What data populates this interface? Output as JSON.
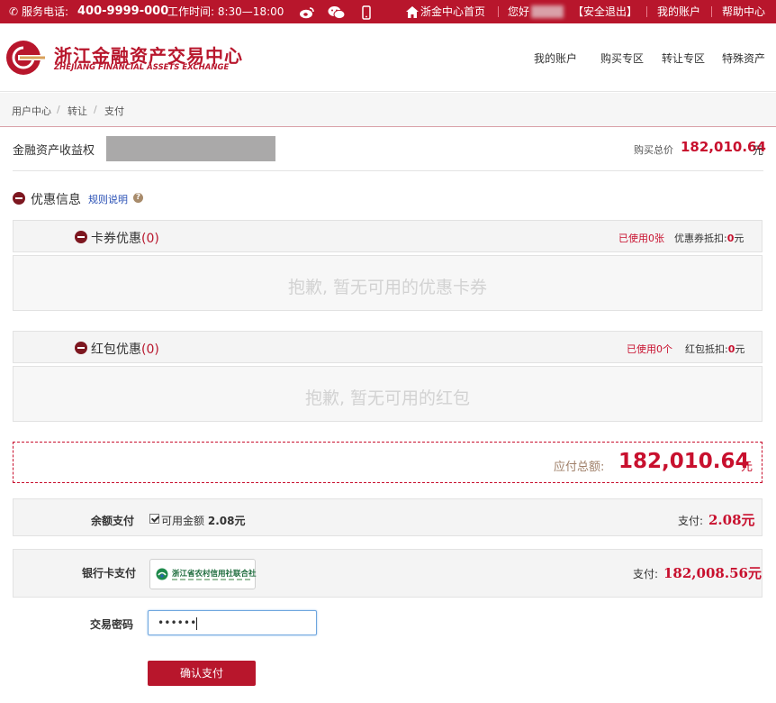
{
  "topbar": {
    "phone_label": "服务电话:",
    "phone_number": "400-9999-000",
    "hours": "工作时间: 8:30—18:00",
    "home_link": "浙金中心首页",
    "greeting": "您好",
    "logout": "【安全退出】",
    "account": "我的账户",
    "help": "帮助中心"
  },
  "header": {
    "logo_cn": "浙江金融资产交易中心",
    "logo_en": "ZHEJIANG FINANCIAL ASSETS EXCHANGE",
    "nav": [
      "我的账户",
      "购买专区",
      "转让专区",
      "特殊资产"
    ]
  },
  "breadcrumb": [
    "用户中心",
    "转让",
    "支付"
  ],
  "product": {
    "title": "金融资产收益权",
    "total_label": "购买总价",
    "total_value": "182,010.64",
    "total_unit": "元"
  },
  "discount": {
    "title": "优惠信息",
    "rules_link": "规则说明",
    "card": {
      "title": "卡券优惠",
      "count": "(0)",
      "used": "已使用0张",
      "deduct_label": "优惠券抵扣:",
      "deduct_value": "0",
      "deduct_unit": "元",
      "empty": "抱歉, 暂无可用的优惠卡券"
    },
    "redpacket": {
      "title": "红包优惠",
      "count": "(0)",
      "used": "已使用0个",
      "deduct_label": "红包抵扣:",
      "deduct_value": "0",
      "deduct_unit": "元",
      "empty": "抱歉, 暂无可用的红包"
    }
  },
  "payable": {
    "label": "应付总额:",
    "value": "182,010.64",
    "unit": "元"
  },
  "balance_pay": {
    "label": "余额支付",
    "available_label": "可用金额",
    "available_value": "2.08元",
    "pay_label": "支付:",
    "pay_value": "2.08元"
  },
  "bank_pay": {
    "label": "银行卡支付",
    "bank_name": "浙江省农村信用社联合社",
    "pay_label": "支付:",
    "pay_value": "182,008.56元"
  },
  "password": {
    "label": "交易密码",
    "masked": "••••••"
  },
  "confirm_button": "确认支付",
  "colors": {
    "brand": "#b8162c",
    "amount": "#c8102e"
  }
}
